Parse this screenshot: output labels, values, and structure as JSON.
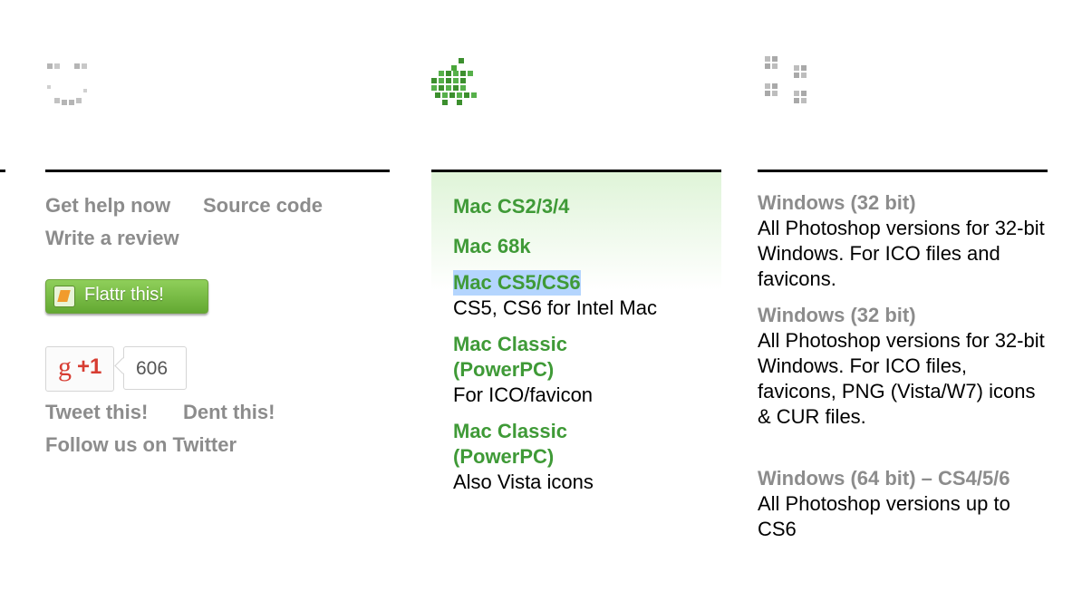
{
  "icons": {
    "left": "smiley-pixel-icon",
    "middle": "apple-pixel-icon",
    "right": "windows-pixel-icon"
  },
  "colors": {
    "green": "#3f9a37",
    "gray": "#8c8c8c",
    "highlight": "#b4d5fe"
  },
  "left": {
    "get_help": "Get help now",
    "source_code": "Source code",
    "write_review": "Write a review",
    "flattr": "Flattr this!",
    "gplus_label": "+1",
    "gplus_count": "606",
    "tweet": "Tweet this!",
    "dent": "Dent this!",
    "follow": "Follow us on Twitter"
  },
  "mac": {
    "items": [
      {
        "title": "Mac CS2/3/4",
        "desc": ""
      },
      {
        "title": "Mac 68k",
        "desc": ""
      },
      {
        "title": "Mac CS5/CS6",
        "desc": "CS5, CS6 for Intel Mac"
      },
      {
        "title_line1": "Mac Classic",
        "title_line2": "(PowerPC)",
        "desc": "For ICO/favicon"
      },
      {
        "title_line1": "Mac Classic",
        "title_line2": "(PowerPC)",
        "desc": "Also Vista icons"
      }
    ]
  },
  "windows": {
    "items": [
      {
        "title": "Windows (32 bit)",
        "desc": "All Photoshop versions for 32-bit Windows. For ICO files and favicons."
      },
      {
        "title": "Windows (32 bit)",
        "desc": "All Photoshop versions for 32-bit Windows. For ICO files, favicons, PNG (Vista/W7) icons & CUR files."
      },
      {
        "title": "Windows (64 bit) – CS4/5/6",
        "desc": "All Photoshop versions up to CS6"
      }
    ]
  }
}
